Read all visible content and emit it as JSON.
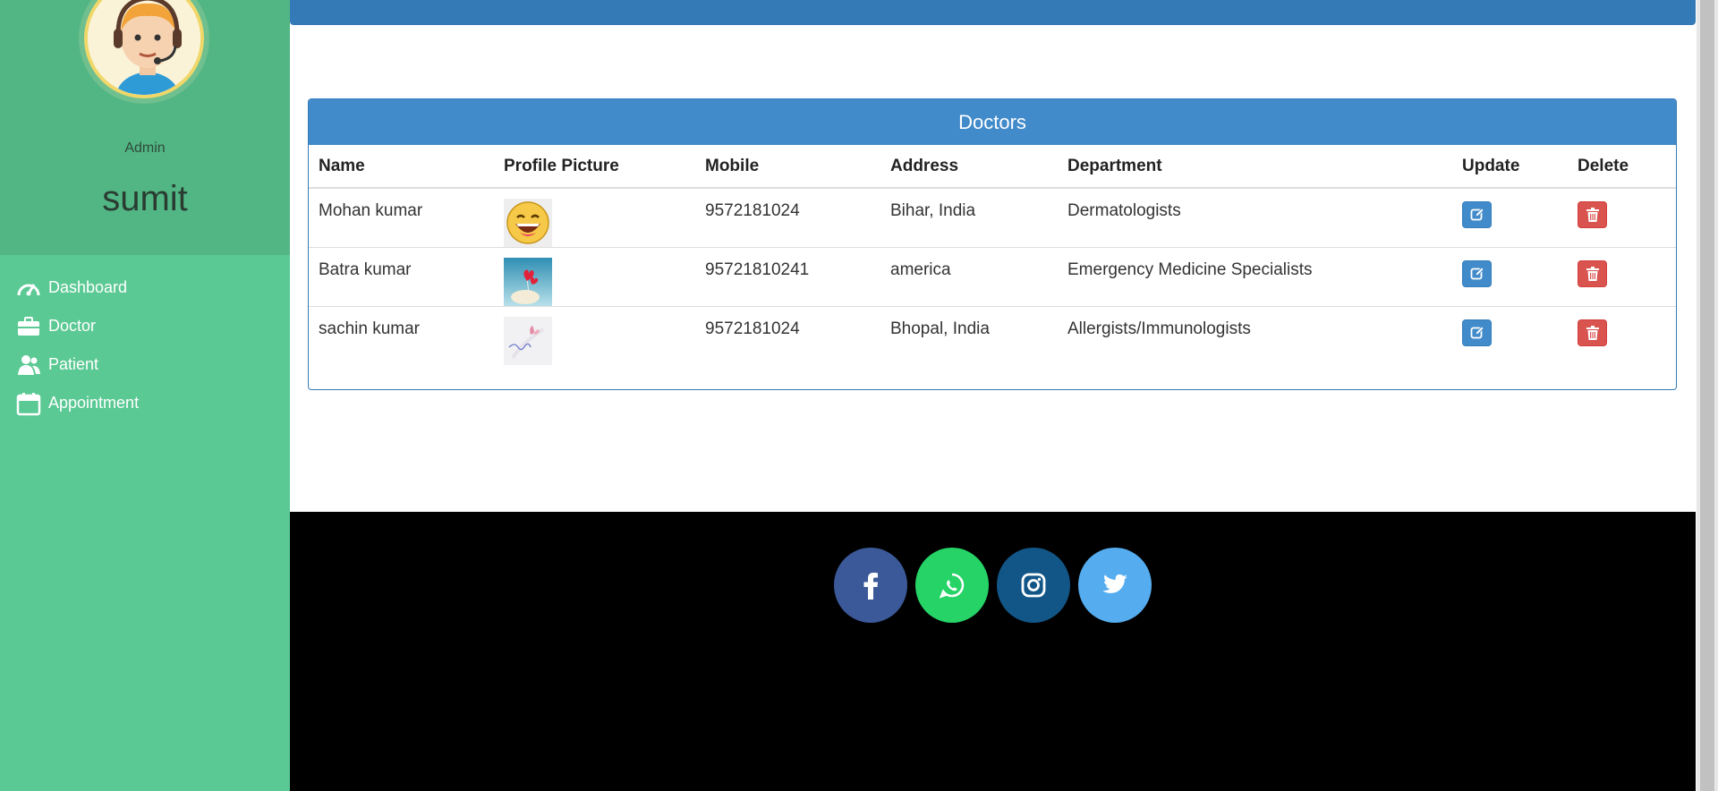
{
  "sidebar": {
    "role": "Admin",
    "username": "sumit",
    "items": [
      {
        "label": "Dashboard",
        "icon": "speedometer-icon"
      },
      {
        "label": "Doctor",
        "icon": "briefcase-icon"
      },
      {
        "label": "Patient",
        "icon": "users-icon"
      },
      {
        "label": "Appointment",
        "icon": "calendar-icon"
      }
    ]
  },
  "panel": {
    "title": "Doctors",
    "columns": [
      "Name",
      "Profile Picture",
      "Mobile",
      "Address",
      "Department",
      "Update",
      "Delete"
    ],
    "rows": [
      {
        "name": "Mohan kumar",
        "mobile": "9572181024",
        "address": "Bihar, India",
        "department": "Dermatologists"
      },
      {
        "name": "Batra kumar",
        "mobile": "95721810241",
        "address": "america",
        "department": "Emergency Medicine Specialists"
      },
      {
        "name": "sachin kumar",
        "mobile": "9572181024",
        "address": "Bhopal, India",
        "department": "Allergists/Immunologists"
      }
    ]
  },
  "footer": {
    "social": [
      "facebook",
      "whatsapp",
      "instagram",
      "twitter"
    ]
  },
  "colors": {
    "sidebar": "#5bc994",
    "sidebar_header": "#52b684",
    "primary": "#428bca",
    "danger": "#d9534f",
    "footer": "#000000",
    "facebook": "#3b5998",
    "whatsapp": "#25d366",
    "instagram": "#125688",
    "twitter": "#55acee"
  }
}
